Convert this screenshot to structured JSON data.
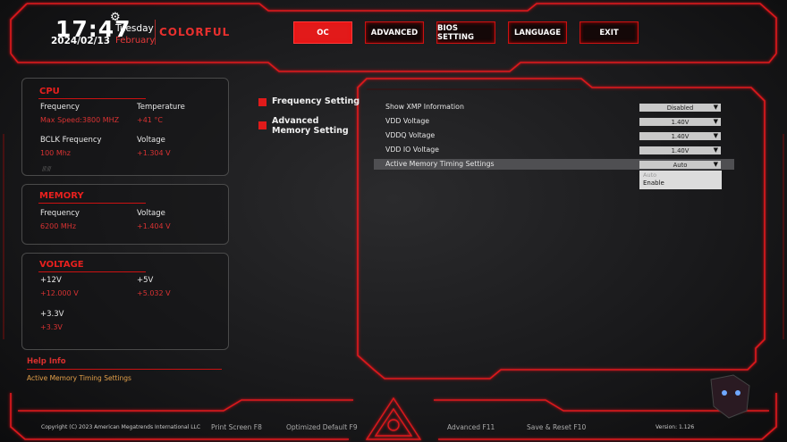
{
  "header": {
    "time": "17:47",
    "day": "Tuesday",
    "date": "2024/02/13",
    "month": "February",
    "brand": "COLORFUL"
  },
  "nav": [
    {
      "label": "OC",
      "active": true
    },
    {
      "label": "ADVANCED",
      "active": false
    },
    {
      "label": "BIOS SETTING",
      "active": false
    },
    {
      "label": "LANGUAGE",
      "active": false
    },
    {
      "label": "EXIT",
      "active": false
    }
  ],
  "cpu": {
    "title": "CPU",
    "frequency_label": "Frequency",
    "frequency_value": "Max Speed:3800 MHZ",
    "temperature_label": "Temperature",
    "temperature_value": "+41 °C",
    "bclk_label": "BCLK Frequency",
    "bclk_value": "100 Mhz",
    "voltage_label": "Voltage",
    "voltage_value": "+1.304 V"
  },
  "memory": {
    "title": "MEMORY",
    "frequency_label": "Frequency",
    "frequency_value": "6200 MHz",
    "voltage_label": "Voltage",
    "voltage_value": "+1.404 V"
  },
  "voltage": {
    "title": "VOLTAGE",
    "v12_label": "+12V",
    "v12_value": "+12.000 V",
    "v5_label": "+5V",
    "v5_value": "+5.032 V",
    "v33_label": "+3.3V",
    "v33_value": "+3.3V"
  },
  "help": {
    "title": "Help Info",
    "text": "Active Memory Timing Settings"
  },
  "menu": [
    {
      "label": "Frequency Setting"
    },
    {
      "label": "Advanced Memory Setting"
    }
  ],
  "settings": [
    {
      "label": "Show XMP Information",
      "value": "Disabled"
    },
    {
      "label": "VDD Voltage",
      "value": "1.40V"
    },
    {
      "label": "VDDQ Voltage",
      "value": "1.40V"
    },
    {
      "label": "VDD IO Voltage",
      "value": "1.40V"
    },
    {
      "label": "Active Memory Timing Settings",
      "value": "Auto"
    }
  ],
  "dropdown_options": [
    "Auto",
    "Enable"
  ],
  "footer": {
    "copyright": "Copyright (C) 2023 American Megatrends International LLC",
    "print_screen": "Print Screen F8",
    "optimized_default": "Optimized Default F9",
    "advanced": "Advanced F11",
    "save_reset": "Save & Reset F10",
    "version": "Version: 1.126"
  },
  "colors": {
    "accent": "#e01a1a",
    "value_red": "#d83232",
    "help_orange": "#e2a04a"
  }
}
